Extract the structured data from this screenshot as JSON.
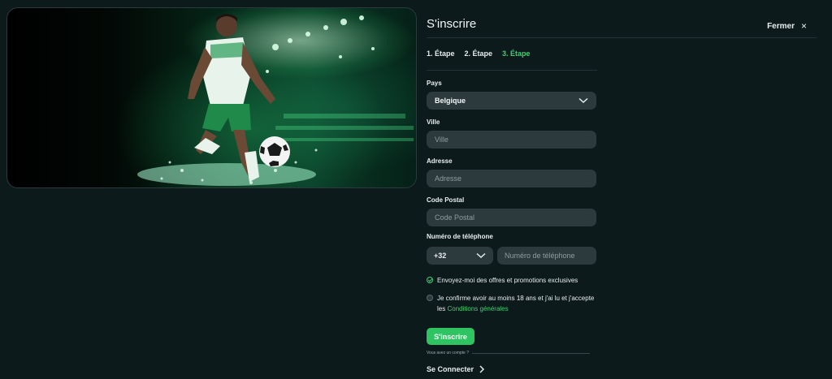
{
  "header": {
    "title": "S'inscrire",
    "close_label": "Fermer",
    "close_glyph": "×"
  },
  "steps": [
    {
      "label": "1. Étape",
      "active": false
    },
    {
      "label": "2. Étape",
      "active": false
    },
    {
      "label": "3. Étape",
      "active": true
    }
  ],
  "form": {
    "country": {
      "label": "Pays",
      "value": "Belgique"
    },
    "city": {
      "label": "Ville",
      "placeholder": "Ville"
    },
    "address": {
      "label": "Adresse",
      "placeholder": "Adresse"
    },
    "postal": {
      "label": "Code Postal",
      "placeholder": "Code Postal"
    },
    "phone": {
      "label": "Numéro de téléphone",
      "code": "+32",
      "placeholder": "Numéro de téléphone"
    },
    "offers_checkbox": {
      "label": "Envoyez-moi des offres et promotions exclusives",
      "checked": true
    },
    "terms_checkbox": {
      "label": "Je confirme avoir au moins 18 ans et j'ai lu et j'accepte les",
      "link": "Conditions générales",
      "checked": false
    },
    "submit_label": "S'inscrire"
  },
  "footer": {
    "account_prompt": "Vous avez un compte ?",
    "login_label": "Se Connecter"
  },
  "colors": {
    "accent": "#3fcf72",
    "button": "#2fc462",
    "background": "#0d1a1c",
    "field": "#2d3a3d"
  },
  "icons": [
    "close-icon",
    "chevron-down-icon",
    "check-icon",
    "chevron-right-icon"
  ]
}
